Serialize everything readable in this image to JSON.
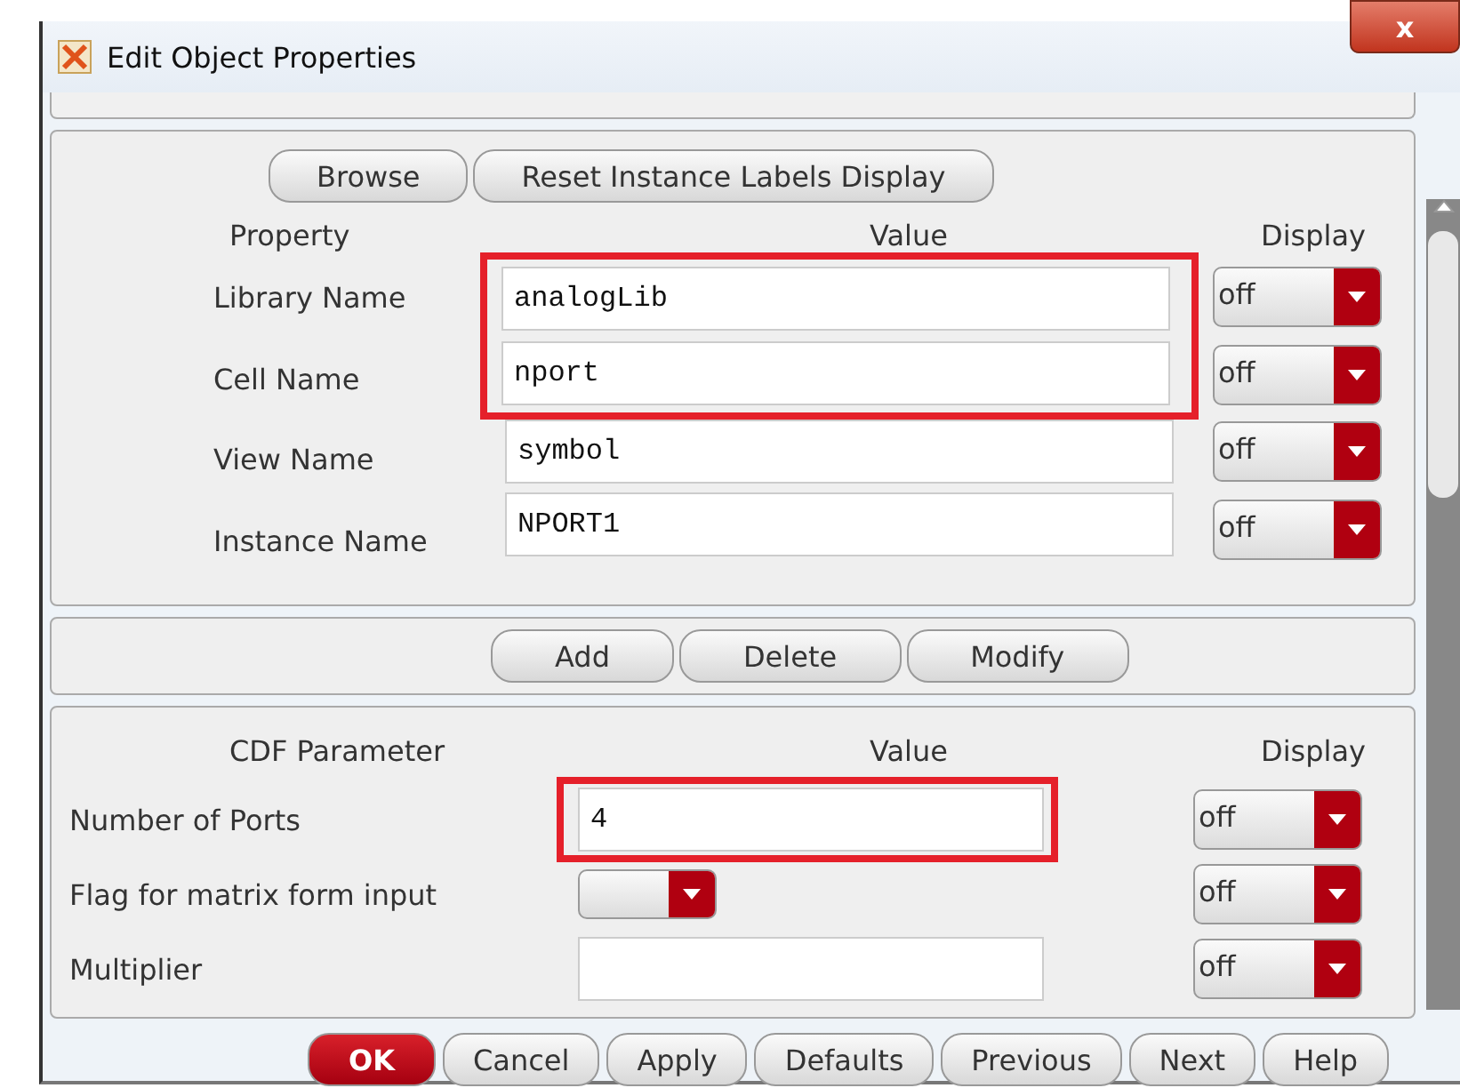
{
  "window": {
    "title": "Edit Object Properties",
    "close": "x"
  },
  "top_buttons": [
    "Browse",
    "Reset Instance Labels Display"
  ],
  "property_headers": [
    "Property",
    "Value",
    "Display"
  ],
  "properties": [
    {
      "label": "Library Name",
      "value": "analogLib",
      "display": "off",
      "highlighted": true
    },
    {
      "label": "Cell Name",
      "value": "nport",
      "display": "off",
      "highlighted": true
    },
    {
      "label": "View Name",
      "value": "symbol",
      "display": "off",
      "highlighted": false
    },
    {
      "label": "Instance Name",
      "value": "NPORT1",
      "display": "off",
      "highlighted": false
    }
  ],
  "middle_buttons": [
    "Add",
    "Delete",
    "Modify"
  ],
  "cdf_headers": [
    "CDF Parameter",
    "Value",
    "Display"
  ],
  "cdf_parameters": [
    {
      "kind": "text",
      "label": "Number of Ports",
      "value": "4",
      "display": "off",
      "highlighted": true
    },
    {
      "kind": "dropdown",
      "label": "Flag for matrix form input",
      "display": "off",
      "highlighted": false
    },
    {
      "kind": "text",
      "label": "Multiplier",
      "display": "off",
      "highlighted": false
    }
  ],
  "bottom_buttons": [
    {
      "label": "OK",
      "primary": true
    },
    {
      "label": "Cancel",
      "primary": false
    },
    {
      "label": "Apply",
      "primary": false
    },
    {
      "label": "Defaults",
      "primary": false
    },
    {
      "label": "Previous",
      "primary": false
    },
    {
      "label": "Next",
      "primary": false
    },
    {
      "label": "Help",
      "primary": false
    }
  ]
}
